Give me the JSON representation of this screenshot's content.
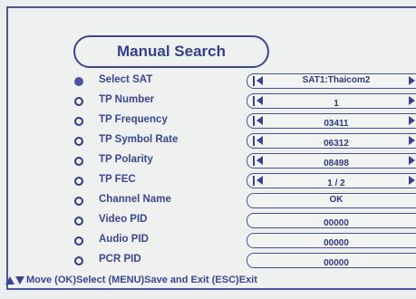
{
  "title": "Manual Search",
  "rows": [
    {
      "label": "Select SAT",
      "value": "SAT1:Thaicom2",
      "arrows": true,
      "selected": true
    },
    {
      "label": "TP Number",
      "value": "1",
      "arrows": true
    },
    {
      "label": "TP Frequency",
      "value": "03411",
      "arrows": true
    },
    {
      "label": "TP Symbol Rate",
      "value": "06312",
      "arrows": true
    },
    {
      "label": "TP Polarity",
      "value": "08498",
      "arrows": true
    },
    {
      "label": "TP FEC",
      "value": "1 / 2",
      "arrows": true
    },
    {
      "label": "Channel Name",
      "value": "OK",
      "arrows": false
    },
    {
      "label": "Video PID",
      "value": "00000",
      "arrows": false
    },
    {
      "label": "Audio PID",
      "value": "00000",
      "arrows": false
    },
    {
      "label": "PCR PID",
      "value": "00000",
      "arrows": false
    }
  ],
  "footer": {
    "text": "Move (OK)Select  (MENU)Save and Exit  (ESC)Exit"
  },
  "colors": {
    "accent": "#3a4799",
    "background": "#ebeeee"
  }
}
